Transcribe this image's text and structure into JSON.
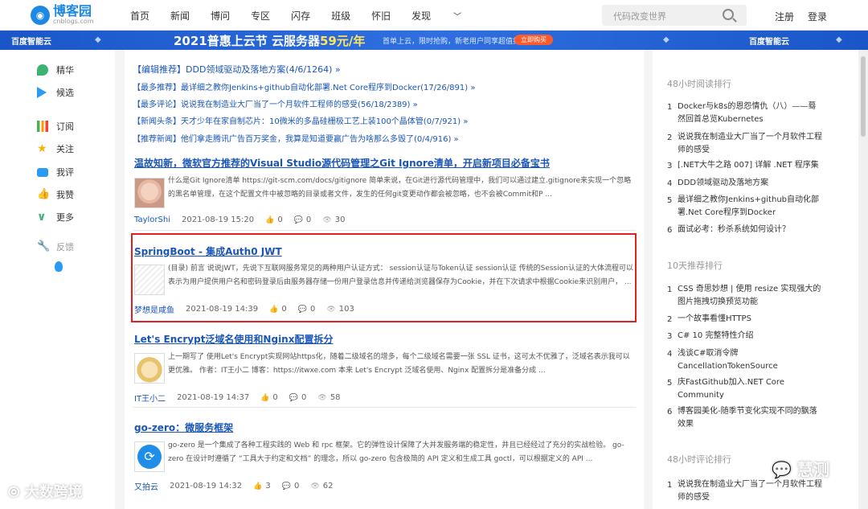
{
  "header": {
    "logo_title": "博客园",
    "logo_sub": "cnblogs.com",
    "nav": [
      "首页",
      "新闻",
      "博问",
      "专区",
      "闪存",
      "班级",
      "怀旧",
      "发现"
    ],
    "search_placeholder": "代码改变世界",
    "register": "注册",
    "login": "登录"
  },
  "banner": {
    "brand": "百度智能云",
    "headline_pre": "2021普惠上云节  云服务器",
    "price": "59元/年",
    "small": "首单上云，限时抢购，新老用户同享超值折扣",
    "button": "立即购买"
  },
  "leftbar": {
    "items": [
      "精华",
      "候选",
      "订阅",
      "关注",
      "我评",
      "我赞",
      "更多",
      "反馈"
    ]
  },
  "main": {
    "recommend": [
      "【编辑推荐】DDD领域驱动及落地方案(4/6/1264) »",
      "【最多推荐】最详细之教你Jenkins+github自动化部署.Net Core程序到Docker(17/26/891) »",
      "【最多评论】说说我在制造业大厂当了一个月软件工程师的感受(56/18/2389) »",
      "【新闻头条】天才少年在家自制芯片：10微米的多晶硅栅极工艺上装100个晶体管(0/7/921) »",
      "【推荐新闻】他们拿走腾讯广告百万奖金，我算是知道要赢广告为啥那么多毁了(0/4/916) »"
    ],
    "posts": [
      {
        "title": "温故知新，微软官方推荐的Visual Studio源代码管理之Git Ignore清单，开启新项目必备宝书",
        "summary": "什么是Git Ignore清单 https://git-scm.com/docs/gitignore 简单来说，在Git进行源代码管理中，我们可以通过建立.gitignore来实现一个忽略的黑名单管理，在这个配置文件中被忽略的目录或者文件，发生的任何git变更动作都会被忽略，也不会被Commit和P ...",
        "author": "TaylorShi",
        "date": "2021-08-19 15:20",
        "likes": "0",
        "comments": "0",
        "views": "30"
      },
      {
        "title": "SpringBoot - 集成Auth0 JWT",
        "summary": "(目录) 前言 说说JWT，先说下互联网服务常见的两种用户认证方式： session认证与Token认证 session认证 传统的Session认证的大体流程可以表示为用户提供用户名和密码登录后由服务器存储一份用户登录信息并传递给浏览器保存为Cookie，并在下次请求中根据Cookie来识别用户， ...",
        "author": "梦想是咸鱼",
        "date": "2021-08-19 14:39",
        "likes": "0",
        "comments": "0",
        "views": "103"
      },
      {
        "title": "Let's Encrypt泛域名使用和Nginx配置拆分",
        "summary": "上一期写了 使用Let's Encrypt实现网站https化，随着二级域名的增多，每个二级域名需要一张 SSL 证书，这可太不优雅了，泛域名表示我可以更优雅。 作者：IT王小二 博客：https://itwxe.com 本来 Let's Encrypt 泛域名使用、Nginx 配置拆分是准备分成 ...",
        "author": "IT王小二",
        "date": "2021-08-19 14:37",
        "likes": "0",
        "comments": "0",
        "views": "58"
      },
      {
        "title": "go-zero：微服务框架",
        "summary": "go-zero 是一个集成了各种工程实践的 Web 和 rpc 框架。它的弹性设计保障了大并发服务端的稳定性，并且已经经过了充分的实战检验。 go-zero 在设计时遵循了 “工具大于约定和文档” 的理念，所以 go-zero 包含极简的 API 定义和生成工具 goctl，可以根据定义的 API ...",
        "author": "又拍云",
        "date": "2021-08-19 14:32",
        "likes": "3",
        "comments": "0",
        "views": "62"
      }
    ]
  },
  "rightbar": {
    "sections": [
      {
        "title": "48小时阅读排行",
        "items": [
          "Docker与k8s的恩怨情仇（八）——蓦然回首总览Kubernetes",
          "说说我在制造业大厂当了一个月软件工程师的感受",
          "[.NET大牛之路 007] 详解 .NET 程序集",
          "DDD领域驱动及落地方案",
          "最详细之教你Jenkins+github自动化部署.Net Core程序到Docker",
          "面试必考：秒杀系统如何设计？"
        ]
      },
      {
        "title": "10天推荐排行",
        "items": [
          "CSS 奇思妙想 | 使用 resize 实现强大的图片拖拽切换预览功能",
          "一个故事看懂HTTPS",
          "C# 10 完整特性介绍",
          "浅谈C#取消令牌CancellationTokenSource",
          "庆FastGithub加入.NET Core Community",
          "博客园美化-随季节变化实现不同的飘落效果"
        ]
      },
      {
        "title": "48小时评论排行",
        "items": [
          "说说我在制造业大厂当了一个月软件工程师的感受"
        ]
      }
    ]
  },
  "watermark": {
    "left": "大数跨境",
    "right": "慧测"
  }
}
